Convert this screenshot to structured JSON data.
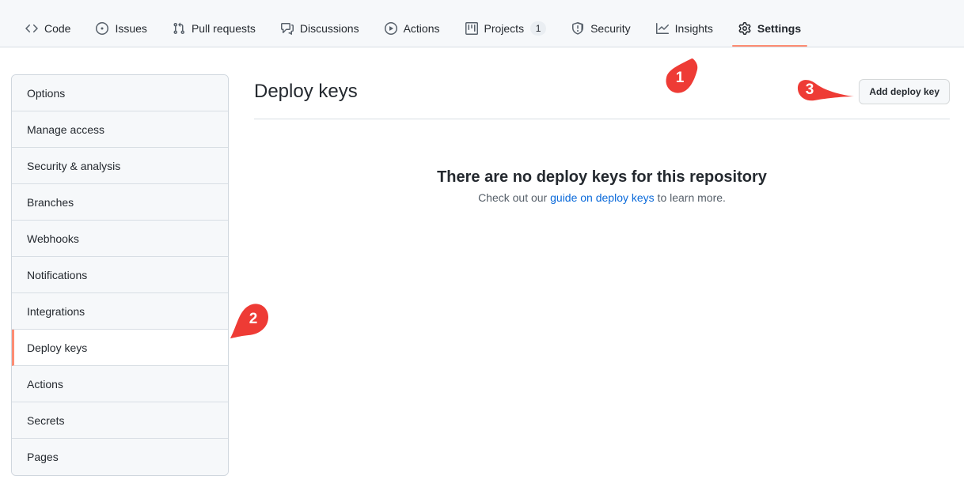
{
  "repo_nav": {
    "items": [
      {
        "label": "Code",
        "icon": "code-icon",
        "active": false,
        "count": null
      },
      {
        "label": "Issues",
        "icon": "issue-opened-icon",
        "active": false,
        "count": null
      },
      {
        "label": "Pull requests",
        "icon": "git-pull-request-icon",
        "active": false,
        "count": null
      },
      {
        "label": "Discussions",
        "icon": "comment-discussion-icon",
        "active": false,
        "count": null
      },
      {
        "label": "Actions",
        "icon": "play-icon",
        "active": false,
        "count": null
      },
      {
        "label": "Projects",
        "icon": "project-icon",
        "active": false,
        "count": "1"
      },
      {
        "label": "Security",
        "icon": "shield-icon",
        "active": false,
        "count": null
      },
      {
        "label": "Insights",
        "icon": "graph-icon",
        "active": false,
        "count": null
      },
      {
        "label": "Settings",
        "icon": "gear-icon",
        "active": true,
        "count": null
      }
    ]
  },
  "sidebar": {
    "items": [
      {
        "label": "Options",
        "selected": false
      },
      {
        "label": "Manage access",
        "selected": false
      },
      {
        "label": "Security & analysis",
        "selected": false
      },
      {
        "label": "Branches",
        "selected": false
      },
      {
        "label": "Webhooks",
        "selected": false
      },
      {
        "label": "Notifications",
        "selected": false
      },
      {
        "label": "Integrations",
        "selected": false
      },
      {
        "label": "Deploy keys",
        "selected": true
      },
      {
        "label": "Actions",
        "selected": false
      },
      {
        "label": "Secrets",
        "selected": false
      },
      {
        "label": "Pages",
        "selected": false
      }
    ]
  },
  "main": {
    "title": "Deploy keys",
    "add_button_label": "Add deploy key",
    "blankslate": {
      "heading": "There are no deploy keys for this repository",
      "text_before": "Check out our ",
      "link": "guide on deploy keys",
      "text_after": " to learn more."
    }
  },
  "annotations": {
    "markers": [
      {
        "number": "1",
        "target": "page-title-area"
      },
      {
        "number": "2",
        "target": "sidebar-item-deploy-keys"
      },
      {
        "number": "3",
        "target": "add-deploy-key-button"
      }
    ],
    "color": "#ee3b35"
  },
  "colors": {
    "accent_orange": "#fd8c73",
    "link_blue": "#0969da",
    "nav_background": "#f6f8fa",
    "border": "#d0d7de",
    "text": "#24292f",
    "muted_text": "#57606a",
    "marker_red": "#ee3b35"
  }
}
